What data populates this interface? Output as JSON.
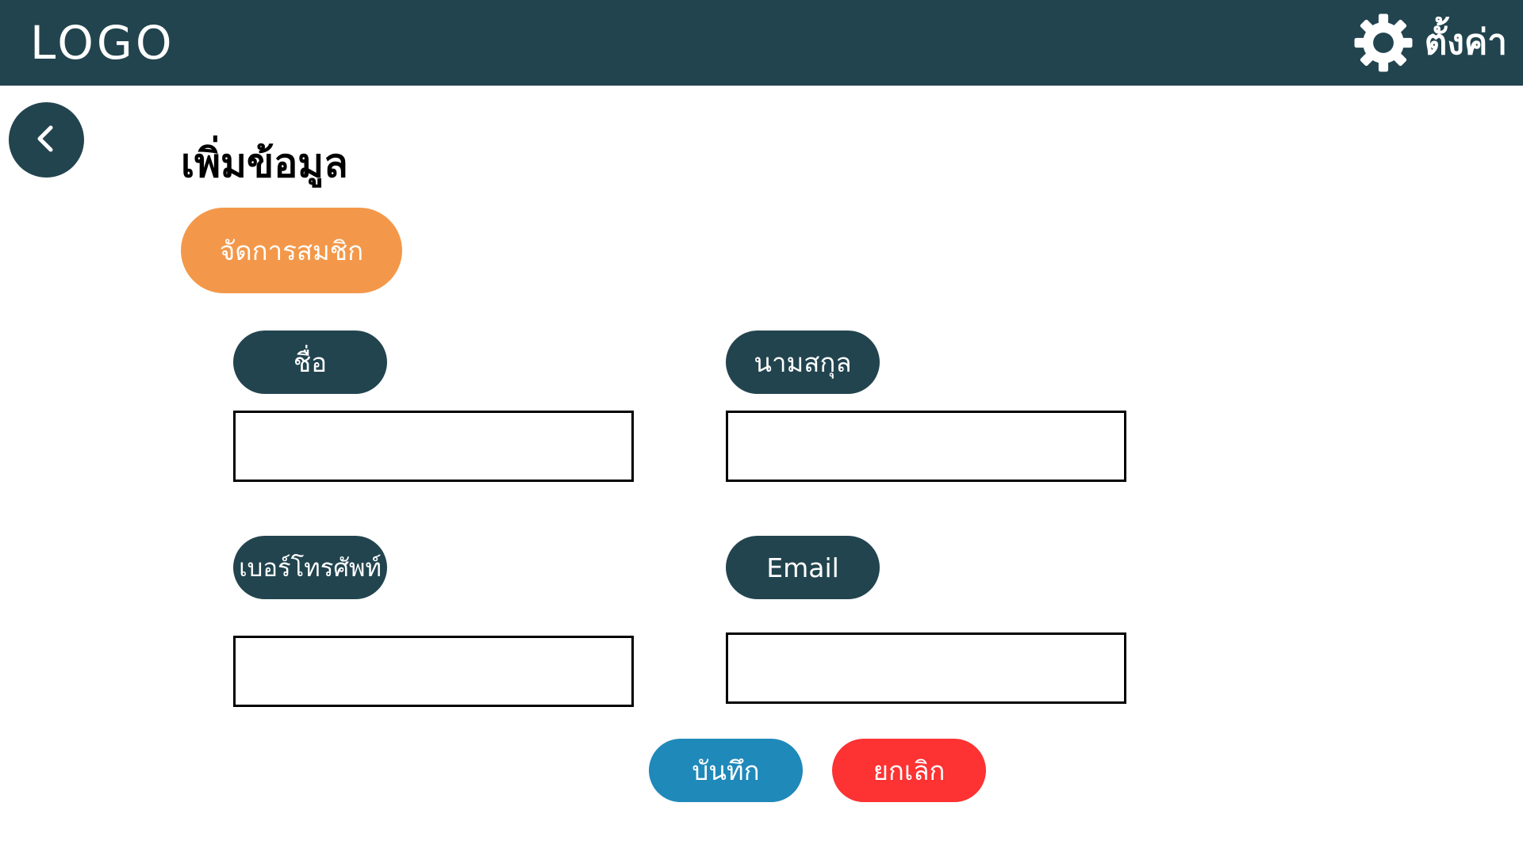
{
  "header": {
    "logo_text": "LOGO",
    "settings_label": "ตั้งค่า",
    "settings_icon": "gear-icon",
    "background": "#22444f"
  },
  "back_button": {
    "icon": "chevron-left-icon"
  },
  "page": {
    "title": "เพิ่มข้อมูล",
    "section_tag": "จัดการสมชิก"
  },
  "form": {
    "first_name": {
      "label": "ชื่อ",
      "value": ""
    },
    "last_name": {
      "label": "นามสกุล",
      "value": ""
    },
    "phone": {
      "label": "เบอร์โทรศัพท์",
      "value": ""
    },
    "email": {
      "label": "Email",
      "value": ""
    }
  },
  "actions": {
    "save_label": "บันทึก",
    "cancel_label": "ยกเลิก"
  },
  "colors": {
    "primary_dark": "#22444f",
    "accent_orange": "#f3984a",
    "save_blue": "#1f89b9",
    "cancel_red": "#fc3233"
  }
}
